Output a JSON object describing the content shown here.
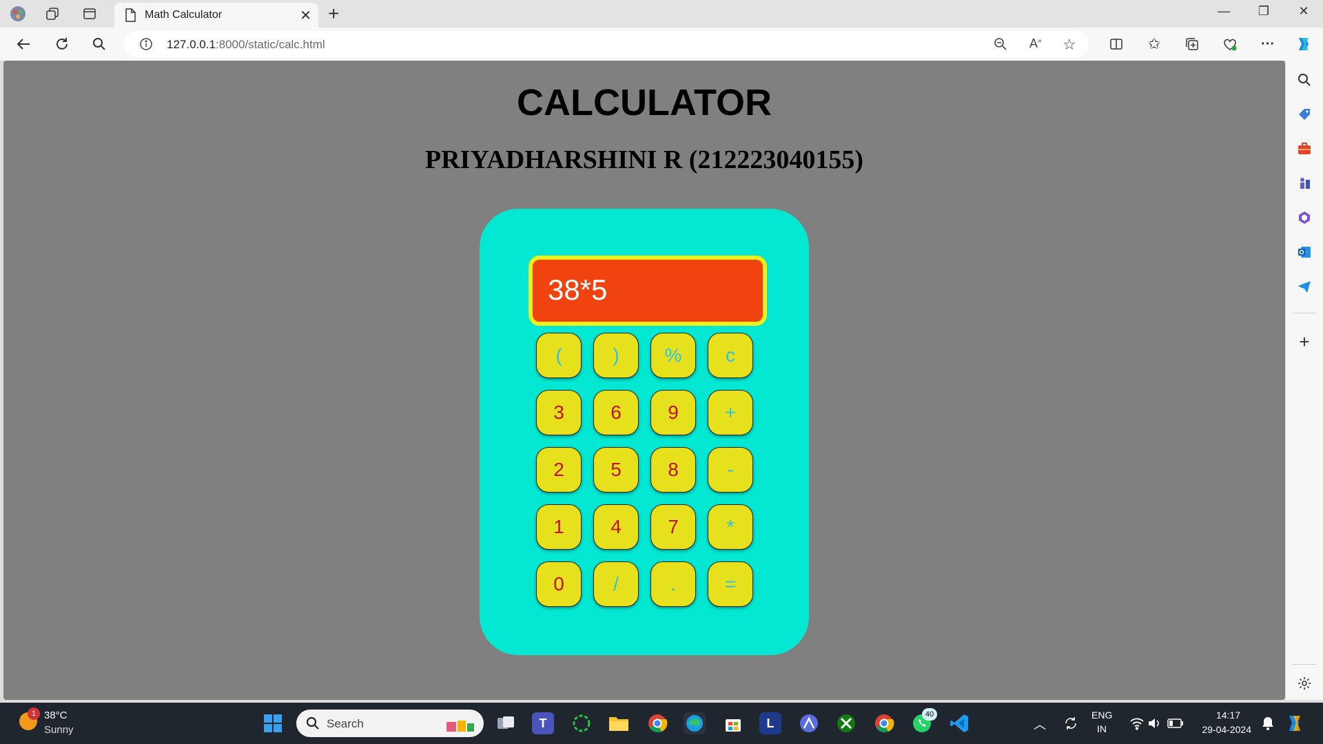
{
  "browser": {
    "tab_title": "Math Calculator",
    "url_host": "127.0.0.1",
    "url_rest": ":8000/static/calc.html"
  },
  "page": {
    "title": "CALCULATOR",
    "subtitle": "PRIYADHARSHINI R (212223040155)"
  },
  "calculator": {
    "display_value": "38*5",
    "keys": {
      "open_paren": "(",
      "close_paren": ")",
      "percent": "%",
      "clear": "c",
      "k3": "3",
      "k6": "6",
      "k9": "9",
      "plus": "+",
      "k2": "2",
      "k5": "5",
      "k8": "8",
      "minus": "-",
      "k1": "1",
      "k4": "4",
      "k7": "7",
      "multiply": "*",
      "k0": "0",
      "divide": "/",
      "dot": ".",
      "equals": "="
    },
    "colors": {
      "body": "#03e8d2",
      "display": "#f0430f",
      "display_border": "#f2ee17",
      "key": "#e6e01d",
      "digit_text": "#c4122b",
      "operator_text": "#2cc4e4"
    }
  },
  "taskbar": {
    "weather_temp": "38°C",
    "weather_condition": "Sunny",
    "weather_badge": "1",
    "search_label": "Search",
    "whatsapp_badge": "40",
    "lang_top": "ENG",
    "lang_bottom": "IN",
    "time": "14:17",
    "date": "29-04-2024"
  }
}
